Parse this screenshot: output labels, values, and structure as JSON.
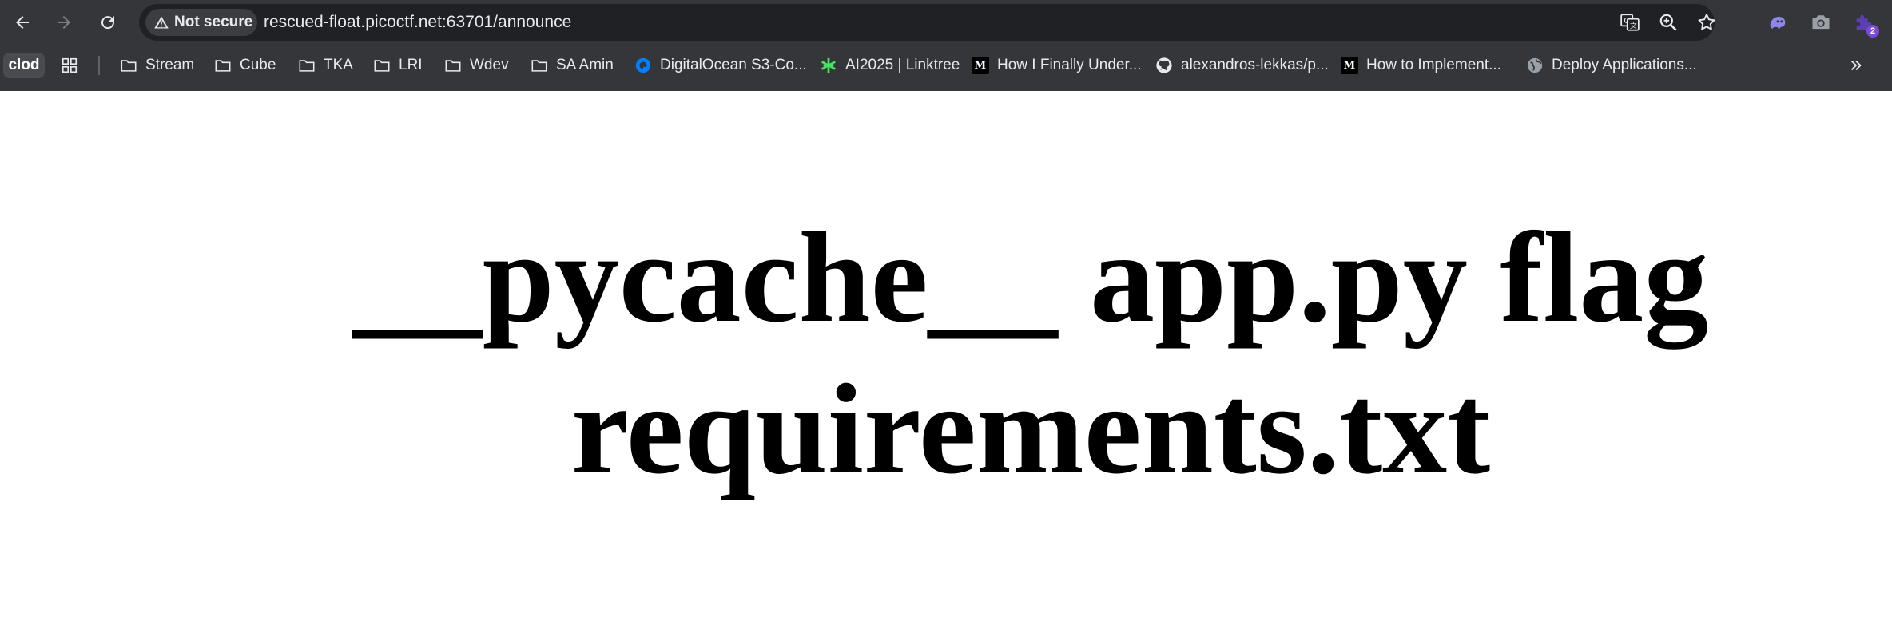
{
  "browser": {
    "security_label": "Not secure",
    "url": "rescued-float.picoctf.net:63701/announce",
    "extensions_badge": "2"
  },
  "bookmarks": {
    "profile_chip": "clod",
    "items": [
      {
        "label": "Stream",
        "icon": "folder-icon"
      },
      {
        "label": "Cube",
        "icon": "folder-icon"
      },
      {
        "label": "TKA",
        "icon": "folder-icon"
      },
      {
        "label": "LRI",
        "icon": "folder-icon"
      },
      {
        "label": "Wdev",
        "icon": "folder-icon"
      },
      {
        "label": "SA Amin",
        "icon": "folder-icon"
      },
      {
        "label": "DigitalOcean S3-Co...",
        "icon": "digitalocean-icon"
      },
      {
        "label": "AI2025 | Linktree",
        "icon": "linktree-icon"
      },
      {
        "label": "How I Finally Under...",
        "icon": "medium-icon"
      },
      {
        "label": "alexandros-lekkas/p...",
        "icon": "github-icon"
      },
      {
        "label": "How to Implement...",
        "icon": "medium-icon"
      },
      {
        "label": "Deploy Applications...",
        "icon": "globe-icon"
      }
    ]
  },
  "page": {
    "listing_text": "__pycache__ app.py flag requirements.txt"
  },
  "colors": {
    "chrome_bg": "#35363a",
    "omnibox_bg": "#202124",
    "text_light": "#e8eaed",
    "page_bg": "#ffffff"
  }
}
